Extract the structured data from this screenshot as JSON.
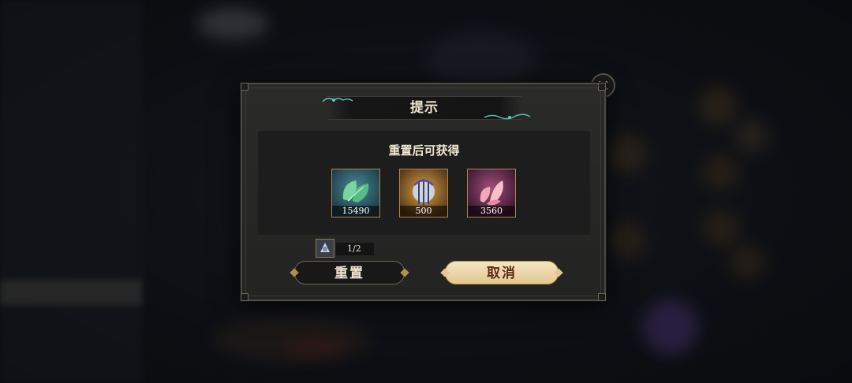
{
  "dialog": {
    "title": "提示",
    "close_icon": "close-x-icon",
    "rewards_heading": "重置后可获得",
    "rewards": [
      {
        "icon": "green-leaf-material-icon",
        "count": "15490",
        "bg": "#2b5a66"
      },
      {
        "icon": "golden-orb-harp-material-icon",
        "count": "500",
        "bg": "#7a5a2a"
      },
      {
        "icon": "pink-petal-material-icon",
        "count": "3560",
        "bg": "#6e3356"
      }
    ],
    "cost": {
      "icon": "reset-token-icon",
      "value": "1/2"
    },
    "reset_button": "重置",
    "cancel_button": "取消"
  },
  "colors": {
    "accent_gold": "#e2c890",
    "text_cream": "#efe6cf",
    "frame_border": "#4c4a44"
  }
}
